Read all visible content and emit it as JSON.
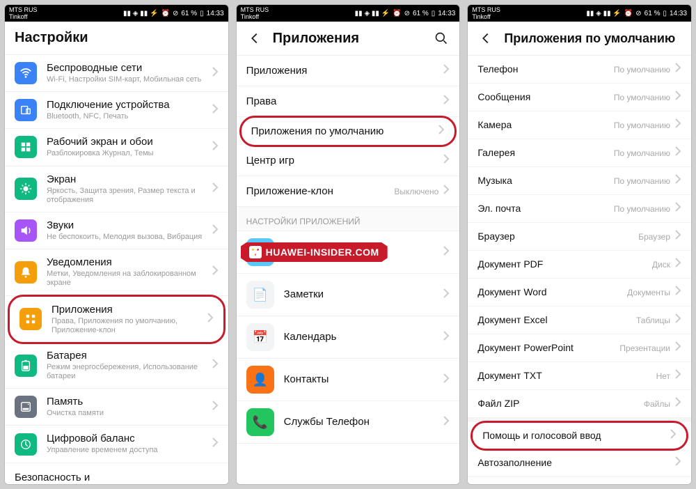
{
  "statusbar": {
    "carrier1": "MTS RUS",
    "carrier2": "Tinkoff",
    "battery": "61 %",
    "time": "14:33"
  },
  "screen1": {
    "title": "Настройки",
    "items": [
      {
        "title": "Беспроводные сети",
        "sub": "Wi-Fi, Настройки SIM-карт, Мобильная сеть",
        "color": "#3b82f6",
        "icon": "wifi"
      },
      {
        "title": "Подключение устройства",
        "sub": "Bluetooth, NFC, Печать",
        "color": "#3b82f6",
        "icon": "device"
      },
      {
        "title": "Рабочий экран и обои",
        "sub": "Разблокировка Журнал, Темы",
        "color": "#10b981",
        "icon": "home"
      },
      {
        "title": "Экран",
        "sub": "Яркость, Защита зрения, Размер текста и отображения",
        "color": "#10b981",
        "icon": "display"
      },
      {
        "title": "Звуки",
        "sub": "Не беспокоить, Мелодия вызова, Вибрация",
        "color": "#a855f7",
        "icon": "sound"
      },
      {
        "title": "Уведомления",
        "sub": "Метки, Уведомления на заблокированном экране",
        "color": "#f59e0b",
        "icon": "bell"
      },
      {
        "title": "Приложения",
        "sub": "Права, Приложения по умолчанию, Приложение-клон",
        "color": "#f59e0b",
        "icon": "apps",
        "hl": true
      },
      {
        "title": "Батарея",
        "sub": "Режим энергосбережения, Использование батареи",
        "color": "#10b981",
        "icon": "battery"
      },
      {
        "title": "Память",
        "sub": "Очистка памяти",
        "color": "#6b7280",
        "icon": "storage"
      },
      {
        "title": "Цифровой баланс",
        "sub": "Управление временем доступа",
        "color": "#10b981",
        "icon": "balance"
      },
      {
        "title": "Безопасность и",
        "sub": "",
        "color": "",
        "icon": ""
      }
    ]
  },
  "screen2": {
    "title": "Приложения",
    "top": [
      {
        "title": "Приложения"
      },
      {
        "title": "Права"
      },
      {
        "title": "Приложения по умолчанию",
        "hl": true
      },
      {
        "title": "Центр игр"
      },
      {
        "title": "Приложение-клон",
        "value": "Выключено"
      }
    ],
    "section": "НАСТРОЙКИ ПРИЛОЖЕНИЙ",
    "watermark": "HUAWEI-INSIDER.COM",
    "apps": [
      {
        "title": "",
        "color": "#5ac8fa"
      },
      {
        "title": "Заметки",
        "color": "#f3f4f6"
      },
      {
        "title": "Календарь",
        "color": "#f3f4f6"
      },
      {
        "title": "Контакты",
        "color": "#f97316"
      },
      {
        "title": "Службы Телефон",
        "color": "#22c55e"
      }
    ]
  },
  "screen3": {
    "title": "Приложения по умолчанию",
    "items": [
      {
        "title": "Телефон",
        "value": "По умолчанию"
      },
      {
        "title": "Сообщения",
        "value": "По умолчанию"
      },
      {
        "title": "Камера",
        "value": "По умолчанию"
      },
      {
        "title": "Галерея",
        "value": "По умолчанию"
      },
      {
        "title": "Музыка",
        "value": "По умолчанию"
      },
      {
        "title": "Эл. почта",
        "value": "По умолчанию"
      },
      {
        "title": "Браузер",
        "value": "Браузер"
      },
      {
        "title": "Документ PDF",
        "value": "Диск"
      },
      {
        "title": "Документ Word",
        "value": "Документы"
      },
      {
        "title": "Документ Excel",
        "value": "Таблицы"
      },
      {
        "title": "Документ PowerPoint",
        "value": "Презентации"
      },
      {
        "title": "Документ TXT",
        "value": "Нет"
      },
      {
        "title": "Файл ZIP",
        "value": "Файлы"
      },
      {
        "title": "Помощь и голосовой ввод",
        "value": "",
        "hl": true
      },
      {
        "title": "Автозаполнение",
        "value": ""
      }
    ]
  }
}
